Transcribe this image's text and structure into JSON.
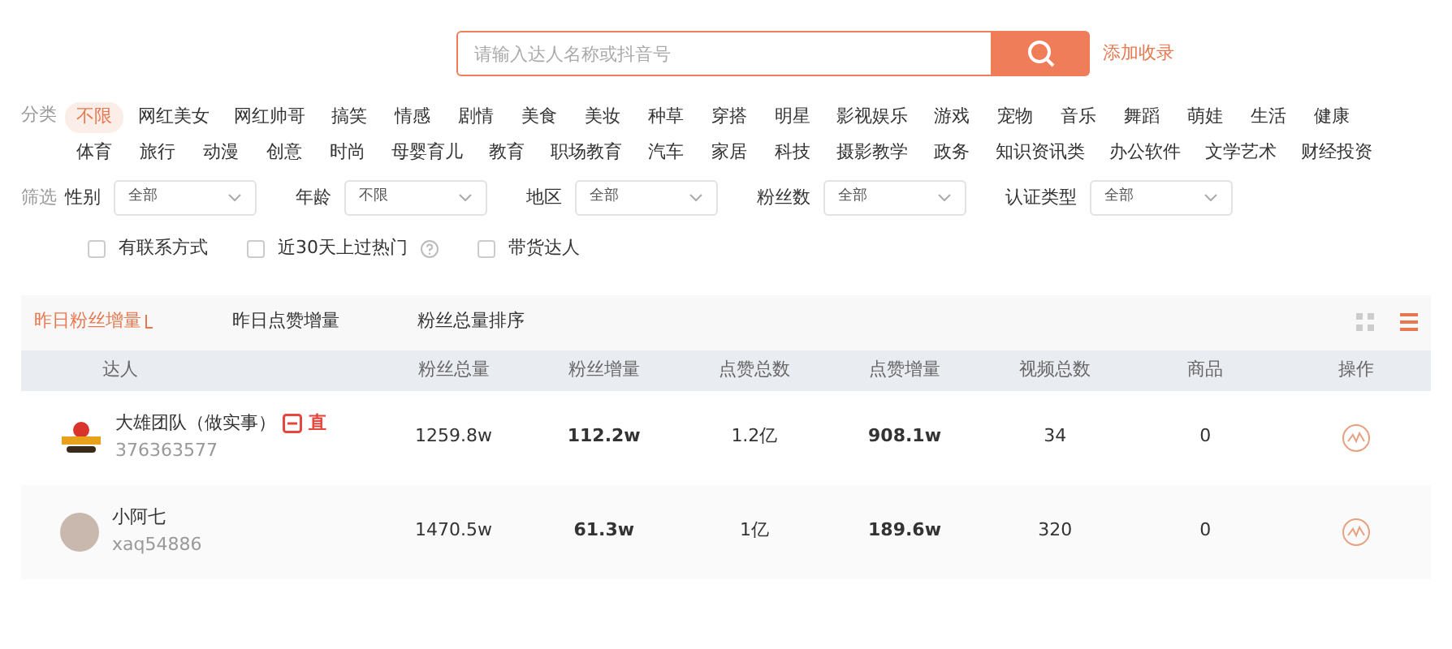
{
  "search": {
    "placeholder": "请输入达人名称或抖音号",
    "link": "添加收录"
  },
  "categories": {
    "label": "分类",
    "items": [
      {
        "label": "不限",
        "selected": true
      },
      {
        "label": "网红美女",
        "selected": false
      },
      {
        "label": "网红帅哥",
        "selected": false
      },
      {
        "label": "搞笑",
        "selected": false
      },
      {
        "label": "情感",
        "selected": false
      },
      {
        "label": "剧情",
        "selected": false
      },
      {
        "label": "美食",
        "selected": false
      },
      {
        "label": "美妆",
        "selected": false
      },
      {
        "label": "种草",
        "selected": false
      },
      {
        "label": "穿搭",
        "selected": false
      },
      {
        "label": "明星",
        "selected": false
      },
      {
        "label": "影视娱乐",
        "selected": false
      },
      {
        "label": "游戏",
        "selected": false
      },
      {
        "label": "宠物",
        "selected": false
      },
      {
        "label": "音乐",
        "selected": false
      },
      {
        "label": "舞蹈",
        "selected": false
      },
      {
        "label": "萌娃",
        "selected": false
      },
      {
        "label": "生活",
        "selected": false
      },
      {
        "label": "健康",
        "selected": false
      },
      {
        "label": "体育",
        "selected": false
      },
      {
        "label": "旅行",
        "selected": false
      },
      {
        "label": "动漫",
        "selected": false
      },
      {
        "label": "创意",
        "selected": false
      },
      {
        "label": "时尚",
        "selected": false
      },
      {
        "label": "母婴育儿",
        "selected": false
      },
      {
        "label": "教育",
        "selected": false
      },
      {
        "label": "职场教育",
        "selected": false
      },
      {
        "label": "汽车",
        "selected": false
      },
      {
        "label": "家居",
        "selected": false
      },
      {
        "label": "科技",
        "selected": false
      },
      {
        "label": "摄影教学",
        "selected": false
      },
      {
        "label": "政务",
        "selected": false
      },
      {
        "label": "知识资讯类",
        "selected": false
      },
      {
        "label": "办公软件",
        "selected": false
      },
      {
        "label": "文学艺术",
        "selected": false
      },
      {
        "label": "财经投资",
        "selected": false
      }
    ]
  },
  "filters": {
    "label": "筛选",
    "items": [
      {
        "label": "性别",
        "value": "全部"
      },
      {
        "label": "年龄",
        "value": "不限"
      },
      {
        "label": "地区",
        "value": "全部"
      },
      {
        "label": "粉丝数",
        "value": "全部"
      },
      {
        "label": "认证类型",
        "value": "全部"
      }
    ]
  },
  "checkboxes": [
    {
      "label": "有联系方式",
      "checked": false,
      "help": false
    },
    {
      "label": "近30天上过热门",
      "checked": false,
      "help": true
    },
    {
      "label": "带货达人",
      "checked": false,
      "help": false
    }
  ],
  "sort_tabs": [
    {
      "label": "昨日粉丝增量",
      "selected": true
    },
    {
      "label": "昨日点赞增量",
      "selected": false
    },
    {
      "label": "粉丝总量排序",
      "selected": false
    }
  ],
  "view": {
    "grid_selected": false,
    "list_selected": true
  },
  "table": {
    "columns": [
      "达人",
      "粉丝总量",
      "粉丝增量",
      "点赞总数",
      "点赞增量",
      "视频总数",
      "商品",
      "操作"
    ],
    "rows": [
      {
        "name": "大雄团队（做实事）",
        "id": "376363577",
        "kind": "logo",
        "shop": true,
        "live": "直",
        "fans_total": "1259.8w",
        "fans_gain": "112.2w",
        "likes_total": "1.2亿",
        "likes_gain": "908.1w",
        "videos": "34",
        "goods": "0"
      },
      {
        "name": "小阿七",
        "id": "xaq54886",
        "kind": "photo",
        "shop": false,
        "live": "",
        "fans_total": "1470.5w",
        "fans_gain": "61.3w",
        "likes_total": "1亿",
        "likes_gain": "189.6w",
        "videos": "320",
        "goods": "0"
      }
    ]
  }
}
